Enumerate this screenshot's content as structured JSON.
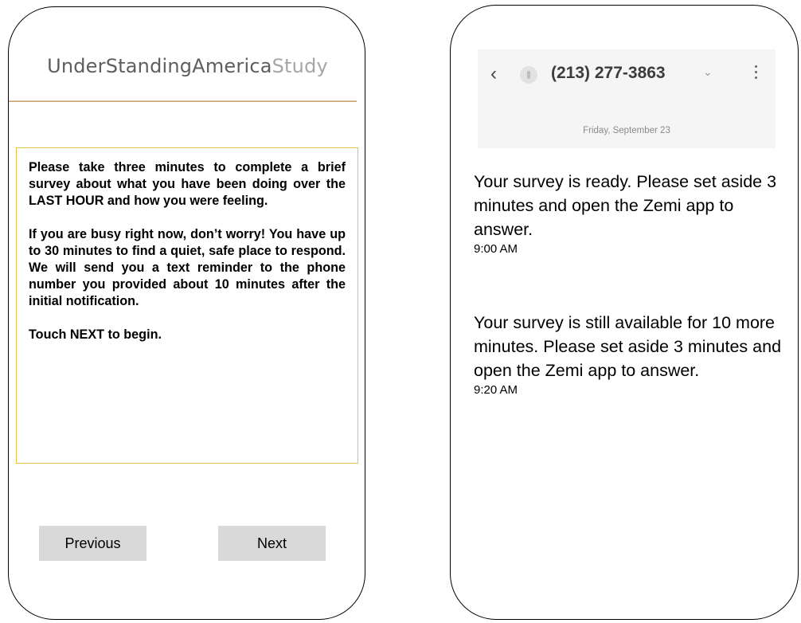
{
  "left_phone": {
    "brand": {
      "part1": "UnderStandingAmerica",
      "part2": "Study"
    },
    "message": {
      "paragraph1": "Please take three minutes to complete a brief survey about what you have been doing over the LAST HOUR and how you were feeling.",
      "paragraph2": "If you are busy right now, don’t worry! You have up to 30 minutes to find a quiet, safe place to respond. We will send you a text reminder to the phone number you provided about 10 minutes after the initial notification.",
      "paragraph3": "Touch NEXT to begin."
    },
    "buttons": {
      "previous": "Previous",
      "next": "Next"
    }
  },
  "right_phone": {
    "header": {
      "back_icon": "chevron-left-icon",
      "contact": "(213) 277-3863",
      "chevron": "⌄",
      "more_icon": "more-vertical-icon",
      "date": "Friday, September 23"
    },
    "messages": [
      {
        "text": "Your survey is ready. Please set aside 3 minutes and open the Zemi app to answer.",
        "time": "9:00 AM"
      },
      {
        "text": "Your survey is still available for 10 more minutes. Please set aside 3 minutes and open the Zemi app to answer.",
        "time": "9:20 AM"
      }
    ]
  },
  "colors": {
    "brand_rule": "#c9a86c",
    "message_border": "#e6c24a",
    "button_bg": "#d9d9d9"
  }
}
